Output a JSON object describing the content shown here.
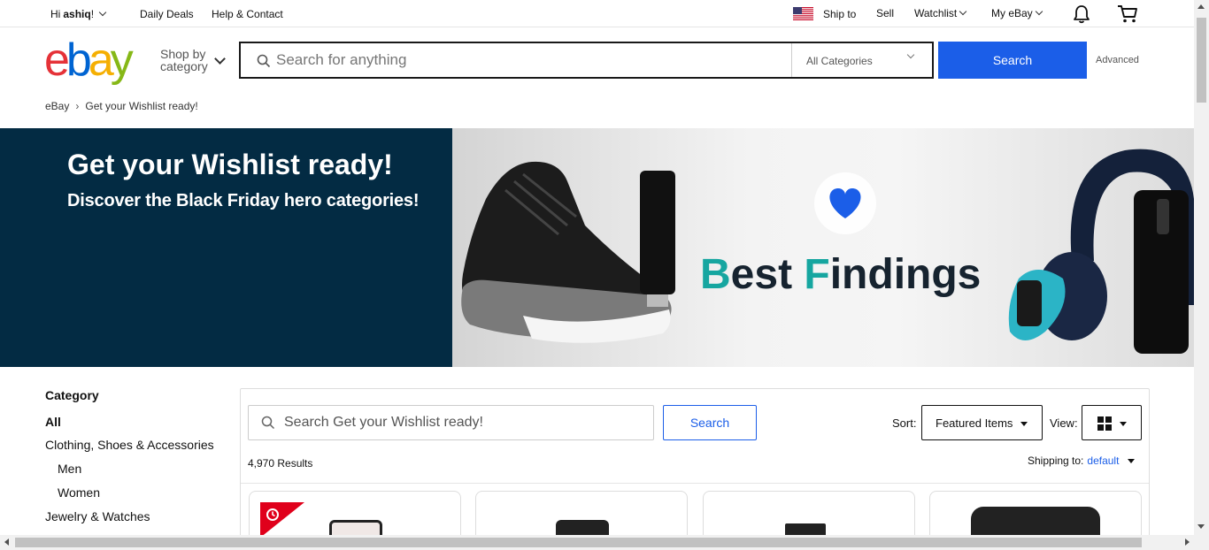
{
  "topbar": {
    "greeting_prefix": "Hi",
    "user_name": "ashiq",
    "greeting_suffix": "!",
    "daily_deals": "Daily Deals",
    "help_contact": "Help & Contact",
    "ship_to": "Ship to",
    "sell": "Sell",
    "watchlist": "Watchlist",
    "my_ebay": "My eBay"
  },
  "header": {
    "logo": [
      "e",
      "b",
      "a",
      "y"
    ],
    "shop_by_line1": "Shop by",
    "shop_by_line2": "category",
    "search_placeholder": "Search for anything",
    "category_select": "All Categories",
    "search_button": "Search",
    "advanced": "Advanced"
  },
  "breadcrumb": {
    "home": "eBay",
    "separator": "›",
    "current": "Get your Wishlist ready!"
  },
  "hero": {
    "title": "Get your Wishlist ready!",
    "subtitle": "Discover the Black Friday hero categories!",
    "banner_word1_initial": "B",
    "banner_word1_rest": "est ",
    "banner_word2_initial": "F",
    "banner_word2_rest": "indings",
    "accent_color": "#16a6a0",
    "heart_color": "#1b5ee8"
  },
  "sidebar": {
    "heading": "Category",
    "items": [
      {
        "label": "All"
      },
      {
        "label": "Clothing, Shoes & Accessories"
      },
      {
        "label": "Men"
      },
      {
        "label": "Women"
      },
      {
        "label": "Jewelry & Watches"
      }
    ]
  },
  "results": {
    "search_placeholder": "Search Get your Wishlist ready!",
    "search_button": "Search",
    "sort_label": "Sort:",
    "sort_value": "Featured Items",
    "view_label": "View:",
    "count": "4,970 Results",
    "shipping_label": "Shipping to:",
    "shipping_value": "default"
  },
  "colors": {
    "primary_blue": "#1b5ee8",
    "hero_dark": "#032b43",
    "deal_badge": "#e0001b"
  }
}
